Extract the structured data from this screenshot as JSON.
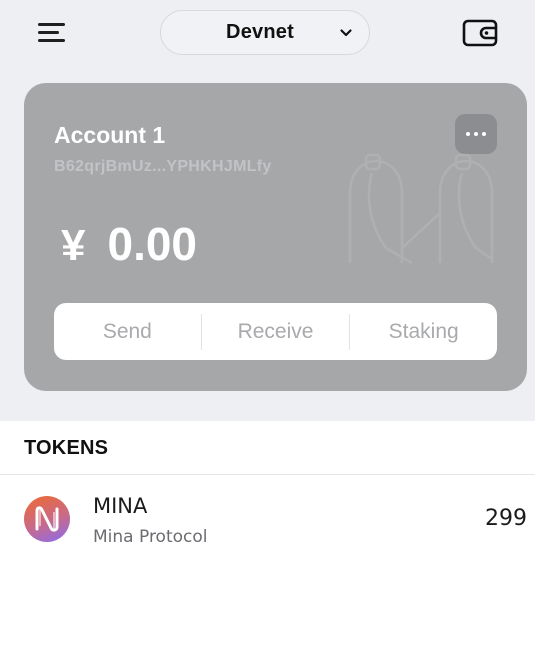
{
  "header": {
    "network": "Devnet",
    "menu_icon": "hamburger-menu-icon",
    "wallet_icon": "wallet-icon",
    "dropdown_icon": "chevron-down-icon"
  },
  "account": {
    "name": "Account 1",
    "address": "B62qrjBmUz...YPHKHJMLfy",
    "currency_symbol": "¥",
    "balance": "0.00",
    "more_icon": "more-horizontal-icon",
    "actions": [
      "Send",
      "Receive",
      "Staking"
    ]
  },
  "tokens": {
    "title": "TOKENS",
    "items": [
      {
        "symbol": "MINA",
        "name": "Mina Protocol",
        "amount": "299",
        "icon": "mina-logo-icon"
      }
    ]
  },
  "colors": {
    "card_bg": "#a6a7a9",
    "top_bg": "#eeeff3",
    "accent_gradient": [
      "#ef6a2e",
      "#8a6cf0"
    ]
  }
}
